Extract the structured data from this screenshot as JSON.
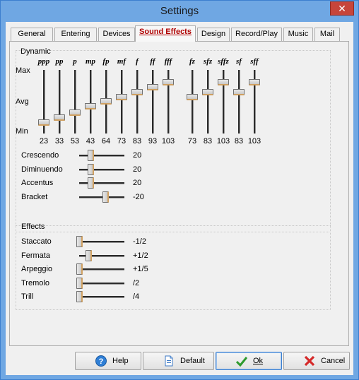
{
  "window": {
    "title": "Settings",
    "close_glyph": "✕"
  },
  "tabs": [
    {
      "label": "General"
    },
    {
      "label": "Entering"
    },
    {
      "label": "Devices"
    },
    {
      "label": "Sound Effects"
    },
    {
      "label": "Design"
    },
    {
      "label": "Record/Play"
    },
    {
      "label": "Music"
    },
    {
      "label": "Mail"
    }
  ],
  "dynamic": {
    "group_label": "Dynamic",
    "axis": {
      "max": "Max",
      "avg": "Avg",
      "min": "Min"
    },
    "sliders": [
      {
        "mark": "ppp",
        "value": "23",
        "level": 0.18
      },
      {
        "mark": "pp",
        "value": "33",
        "level": 0.26
      },
      {
        "mark": "p",
        "value": "53",
        "level": 0.33
      },
      {
        "mark": "mp",
        "value": "43",
        "level": 0.43
      },
      {
        "mark": "fp",
        "value": "64",
        "level": 0.51
      },
      {
        "mark": "mf",
        "value": "73",
        "level": 0.58
      },
      {
        "mark": "f",
        "value": "83",
        "level": 0.66
      },
      {
        "mark": "ff",
        "value": "93",
        "level": 0.73
      },
      {
        "mark": "fff",
        "value": "103",
        "level": 0.81
      },
      {
        "mark": "fz",
        "value": "73",
        "level": 0.58
      },
      {
        "mark": "sfz",
        "value": "83",
        "level": 0.66
      },
      {
        "mark": "sffz",
        "value": "103",
        "level": 0.81
      },
      {
        "mark": "sf",
        "value": "83",
        "level": 0.66
      },
      {
        "mark": "sff",
        "value": "103",
        "level": 0.81
      }
    ],
    "h_sliders": [
      {
        "label": "Crescendo",
        "value": "20",
        "level": 0.25
      },
      {
        "label": "Diminuendo",
        "value": "20",
        "level": 0.25
      },
      {
        "label": "Accentus",
        "value": "20",
        "level": 0.25
      },
      {
        "label": "Bracket",
        "value": "-20",
        "level": 0.58
      }
    ]
  },
  "effects": {
    "group_label": "Effects",
    "h_sliders": [
      {
        "label": "Staccato",
        "value": "-1/2",
        "level": 0.0
      },
      {
        "label": "Fermata",
        "value": "+1/2",
        "level": 0.2
      },
      {
        "label": "Arpeggio",
        "value": "+1/5",
        "level": 0.0
      },
      {
        "label": "Tremolo",
        "value": "/2",
        "level": 0.0
      },
      {
        "label": "Trill",
        "value": "/4",
        "level": 0.0
      }
    ]
  },
  "buttons": {
    "help": "Help",
    "default": "Default",
    "ok": "Ok",
    "cancel": "Cancel"
  },
  "colors": {
    "title_bar": "#6fa7e3",
    "active_tab_text": "#b00000",
    "close_button": "#c7453a"
  }
}
